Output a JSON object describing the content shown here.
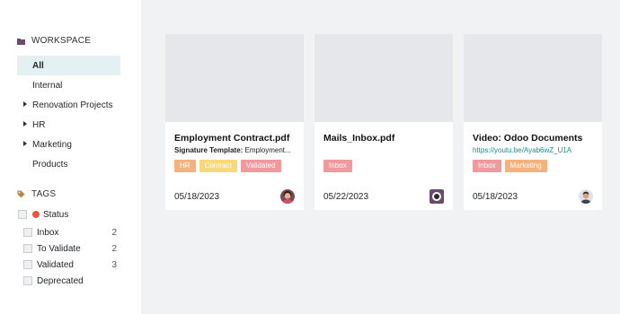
{
  "sidebar": {
    "workspace_label": "WORKSPACE",
    "workspace_icon": "folder-icon",
    "workspaces": [
      {
        "label": "All",
        "active": true,
        "expandable": false
      },
      {
        "label": "Internal",
        "active": false,
        "expandable": false
      },
      {
        "label": "Renovation Projects",
        "active": false,
        "expandable": true
      },
      {
        "label": "HR",
        "active": false,
        "expandable": true
      },
      {
        "label": "Marketing",
        "active": false,
        "expandable": true
      },
      {
        "label": "Products",
        "active": false,
        "expandable": false
      }
    ],
    "tags_label": "TAGS",
    "tags_icon": "tag-icon",
    "status": {
      "label": "Status",
      "color": "#e4583f"
    },
    "tag_items": [
      {
        "label": "Inbox",
        "count": "2"
      },
      {
        "label": "To Validate",
        "count": "2"
      },
      {
        "label": "Validated",
        "count": "3"
      },
      {
        "label": "Deprecated",
        "count": ""
      }
    ]
  },
  "documents": [
    {
      "title": "Employment Contract.pdf",
      "subtitle_label": "Signature Template:",
      "subtitle_value": "Employment...",
      "tags": [
        {
          "label": "HR",
          "color": "#f5b27d"
        },
        {
          "label": "Contract",
          "color": "#f7d97a"
        },
        {
          "label": "Validated",
          "color": "#f09a9e"
        }
      ],
      "date": "05/18/2023",
      "avatar": "user-avatar-woman"
    },
    {
      "title": "Mails_Inbox.pdf",
      "tags": [
        {
          "label": "Inbox",
          "color": "#f09a9e"
        }
      ],
      "date": "05/22/2023",
      "avatar": "bot-avatar"
    },
    {
      "title": "Video: Odoo Documents",
      "link": "https://youtu.be/Ayab6wZ_U1A",
      "tags": [
        {
          "label": "Inbox",
          "color": "#f09a9e"
        },
        {
          "label": "Marketing",
          "color": "#f5b27d"
        }
      ],
      "date": "05/18/2023",
      "avatar": "user-avatar-man"
    }
  ]
}
